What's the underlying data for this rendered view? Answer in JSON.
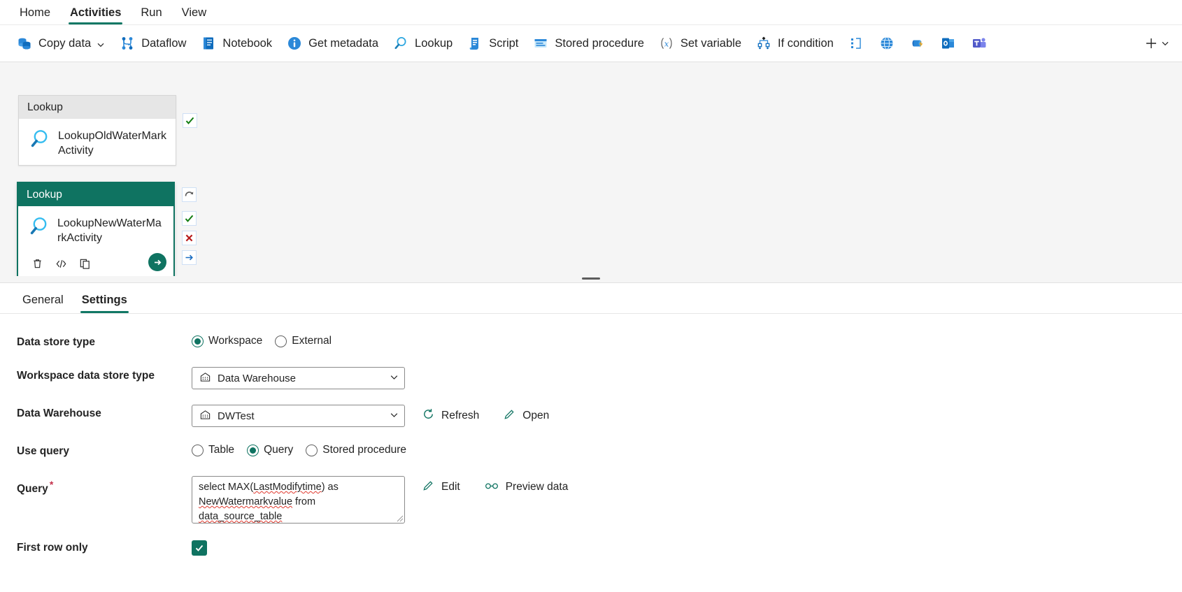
{
  "ribbon": {
    "tabs": [
      {
        "label": "Home",
        "active": false
      },
      {
        "label": "Activities",
        "active": true
      },
      {
        "label": "Run",
        "active": false
      },
      {
        "label": "View",
        "active": false
      }
    ]
  },
  "toolbar": {
    "items": [
      {
        "label": "Copy data",
        "icon": "copy-data-icon",
        "has_chevron": true
      },
      {
        "label": "Dataflow",
        "icon": "dataflow-icon",
        "has_chevron": false
      },
      {
        "label": "Notebook",
        "icon": "notebook-icon",
        "has_chevron": false
      },
      {
        "label": "Get metadata",
        "icon": "info-icon",
        "has_chevron": false
      },
      {
        "label": "Lookup",
        "icon": "magnifier-icon",
        "has_chevron": false
      },
      {
        "label": "Script",
        "icon": "script-icon",
        "has_chevron": false
      },
      {
        "label": "Stored procedure",
        "icon": "stored-procedure-icon",
        "has_chevron": false
      },
      {
        "label": "Set variable",
        "icon": "set-variable-icon",
        "has_chevron": false
      },
      {
        "label": "If condition",
        "icon": "if-condition-icon",
        "has_chevron": false
      }
    ],
    "icon_only": [
      {
        "icon": "switch-activity-icon"
      },
      {
        "icon": "web-globe-icon"
      },
      {
        "icon": "azure-function-icon"
      },
      {
        "icon": "outlook-icon"
      },
      {
        "icon": "teams-icon"
      }
    ],
    "add_label": "+",
    "add_chevron_icon": "chevron-down-icon"
  },
  "canvas": {
    "nodes": [
      {
        "type": "Lookup",
        "name": "LookupOldWaterMarkActivity",
        "selected": false,
        "icon": "magnifier-icon",
        "chips": [
          {
            "icon": "success-check-icon"
          }
        ]
      },
      {
        "type": "Lookup",
        "name": "LookupNewWaterMarkActivity",
        "selected": true,
        "icon": "magnifier-icon",
        "chips": [
          {
            "icon": "retry-arrow-icon"
          },
          {
            "icon": "success-check-icon"
          },
          {
            "icon": "failure-x-icon"
          },
          {
            "icon": "skip-arrow-icon"
          }
        ],
        "actions": [
          {
            "icon": "delete-trash-icon"
          },
          {
            "icon": "code-view-icon"
          },
          {
            "icon": "duplicate-copy-icon"
          }
        ],
        "run_icon": "run-arrow-icon"
      }
    ]
  },
  "properties": {
    "tabs": [
      {
        "label": "General",
        "active": false
      },
      {
        "label": "Settings",
        "active": true
      }
    ],
    "fields": {
      "data_store_type": {
        "label": "Data store type",
        "options": [
          {
            "label": "Workspace",
            "selected": true
          },
          {
            "label": "External",
            "selected": false
          }
        ]
      },
      "workspace_data_store_type": {
        "label": "Workspace data store type",
        "value": "Data Warehouse",
        "icon": "warehouse-icon",
        "chevron": "chevron-down-icon"
      },
      "data_warehouse": {
        "label": "Data Warehouse",
        "value": "DWTest",
        "icon": "warehouse-icon",
        "chevron": "chevron-down-icon",
        "refresh_label": "Refresh",
        "refresh_icon": "refresh-icon",
        "open_label": "Open",
        "open_icon": "pencil-edit-icon"
      },
      "use_query": {
        "label": "Use query",
        "options": [
          {
            "label": "Table",
            "selected": false
          },
          {
            "label": "Query",
            "selected": true
          },
          {
            "label": "Stored procedure",
            "selected": false
          }
        ]
      },
      "query": {
        "label": "Query",
        "required": true,
        "value_parts": [
          {
            "text": "select MAX(",
            "spell": false
          },
          {
            "text": "LastModifytime",
            "spell": true
          },
          {
            "text": ") as ",
            "spell": false
          },
          {
            "text": "NewWatermarkvalue",
            "spell": true
          },
          {
            "text": " from ",
            "spell": false
          },
          {
            "text": "data_source_table",
            "spell": true
          }
        ],
        "value": "select MAX(LastModifytime) as NewWatermarkvalue from data_source_table",
        "edit_label": "Edit",
        "edit_icon": "pencil-edit-icon",
        "preview_label": "Preview data",
        "preview_icon": "glasses-preview-icon"
      },
      "first_row_only": {
        "label": "First row only",
        "checked": true,
        "icon": "checkmark-icon"
      }
    }
  },
  "colors": {
    "accent": "#117865",
    "node_selected": "#0f7361",
    "required": "#c4314b",
    "spell_error": "#e03a2f"
  }
}
